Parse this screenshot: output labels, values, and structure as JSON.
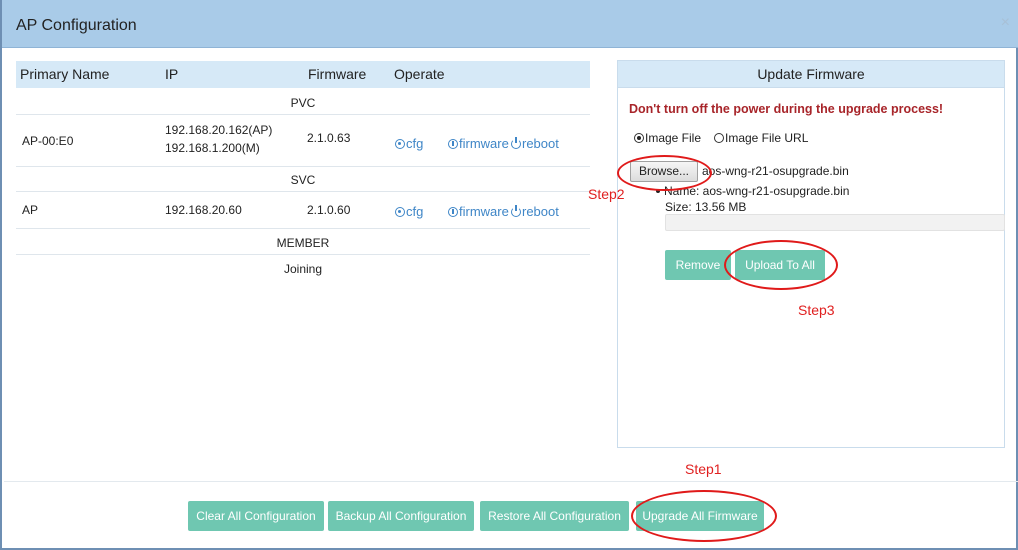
{
  "window": {
    "title": "AP Configuration",
    "close_glyph": "×"
  },
  "table": {
    "columns": [
      "Primary Name",
      "IP",
      "Firmware",
      "Operate"
    ],
    "groups": {
      "pvc": "PVC",
      "svc": "SVC",
      "member": "MEMBER",
      "joining": "Joining"
    },
    "rows": [
      {
        "name": "AP-00:E0",
        "ip1": "192.168.20.162(AP)",
        "ip2": "192.168.1.200(M)",
        "firmware": "2.1.0.63",
        "op_cfg": "cfg",
        "op_firmware": "firmware",
        "op_reboot": "reboot"
      },
      {
        "name": "AP",
        "ip1": "192.168.20.60",
        "firmware": "2.1.0.60",
        "op_cfg": "cfg",
        "op_firmware": "firmware",
        "op_reboot": "reboot"
      }
    ],
    "icons": {
      "cfg": "eye-icon",
      "firmware": "info-icon",
      "reboot": "power-icon"
    }
  },
  "update_firmware": {
    "title": "Update Firmware",
    "warning": "Don't turn off the power during the upgrade process!",
    "radio_image_file": "Image File",
    "radio_image_url": "Image File URL",
    "selected": "Image File",
    "browse_label": "Browse...",
    "file_name": "aos-wng-r21-osupgrade.bin",
    "info_name": "Name: aos-wng-r21-osupgrade.bin",
    "info_size": "Size: 13.56 MB",
    "progress": 0,
    "remove_label": "Remove",
    "upload_label": "Upload To All"
  },
  "footer": {
    "clear_label": "Clear All Configuration",
    "backup_label": "Backup All Configuration",
    "restore_label": "Restore All Configuration",
    "upgrade_label": "Upgrade All Firmware"
  },
  "annotations": {
    "step1": "Step1",
    "step2": "Step2",
    "step3": "Step3"
  },
  "colors": {
    "header": "#a9cbe8",
    "table_header": "#d6e9f7",
    "button": "#6fc7b1",
    "link": "#3f86c7",
    "warning": "#a8252a",
    "annotation": "#e02020"
  }
}
